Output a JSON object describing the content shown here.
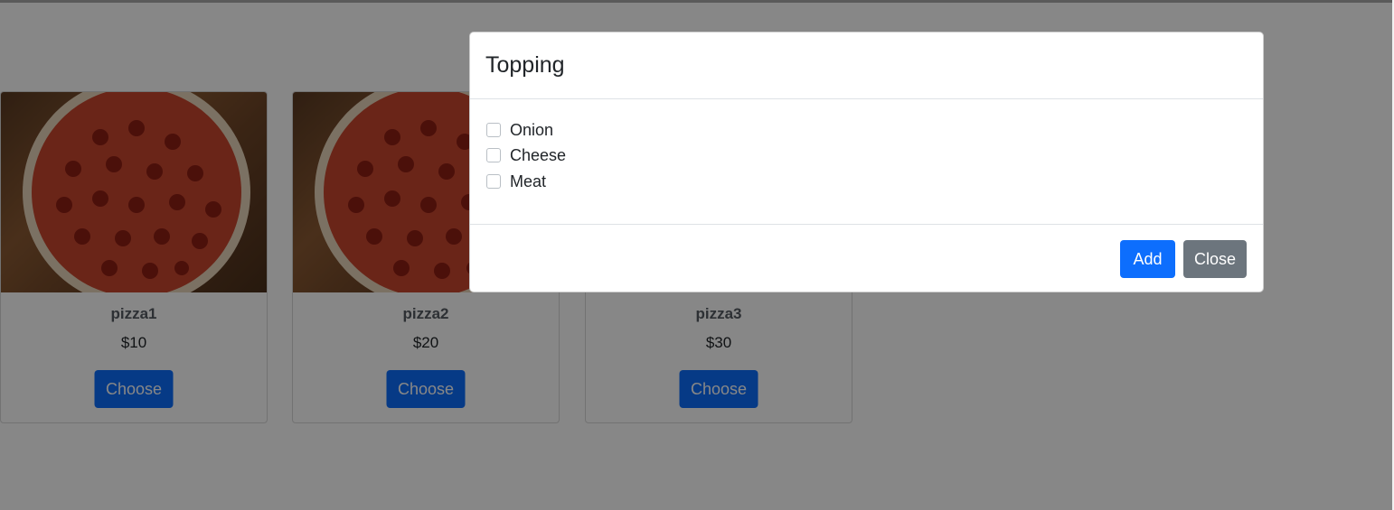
{
  "pizzas": [
    {
      "name": "pizza1",
      "price": "$10",
      "button": "Choose"
    },
    {
      "name": "pizza2",
      "price": "$20",
      "button": "Choose"
    },
    {
      "name": "pizza3",
      "price": "$30",
      "button": "Choose"
    }
  ],
  "modal": {
    "title": "Topping",
    "options": [
      {
        "label": "Onion",
        "checked": false
      },
      {
        "label": "Cheese",
        "checked": false
      },
      {
        "label": "Meat",
        "checked": false
      }
    ],
    "add_label": "Add",
    "close_label": "Close"
  },
  "colors": {
    "primary": "#0d6efd",
    "secondary": "#6c757d",
    "backdrop": "rgba(0,0,0,0.47)"
  }
}
